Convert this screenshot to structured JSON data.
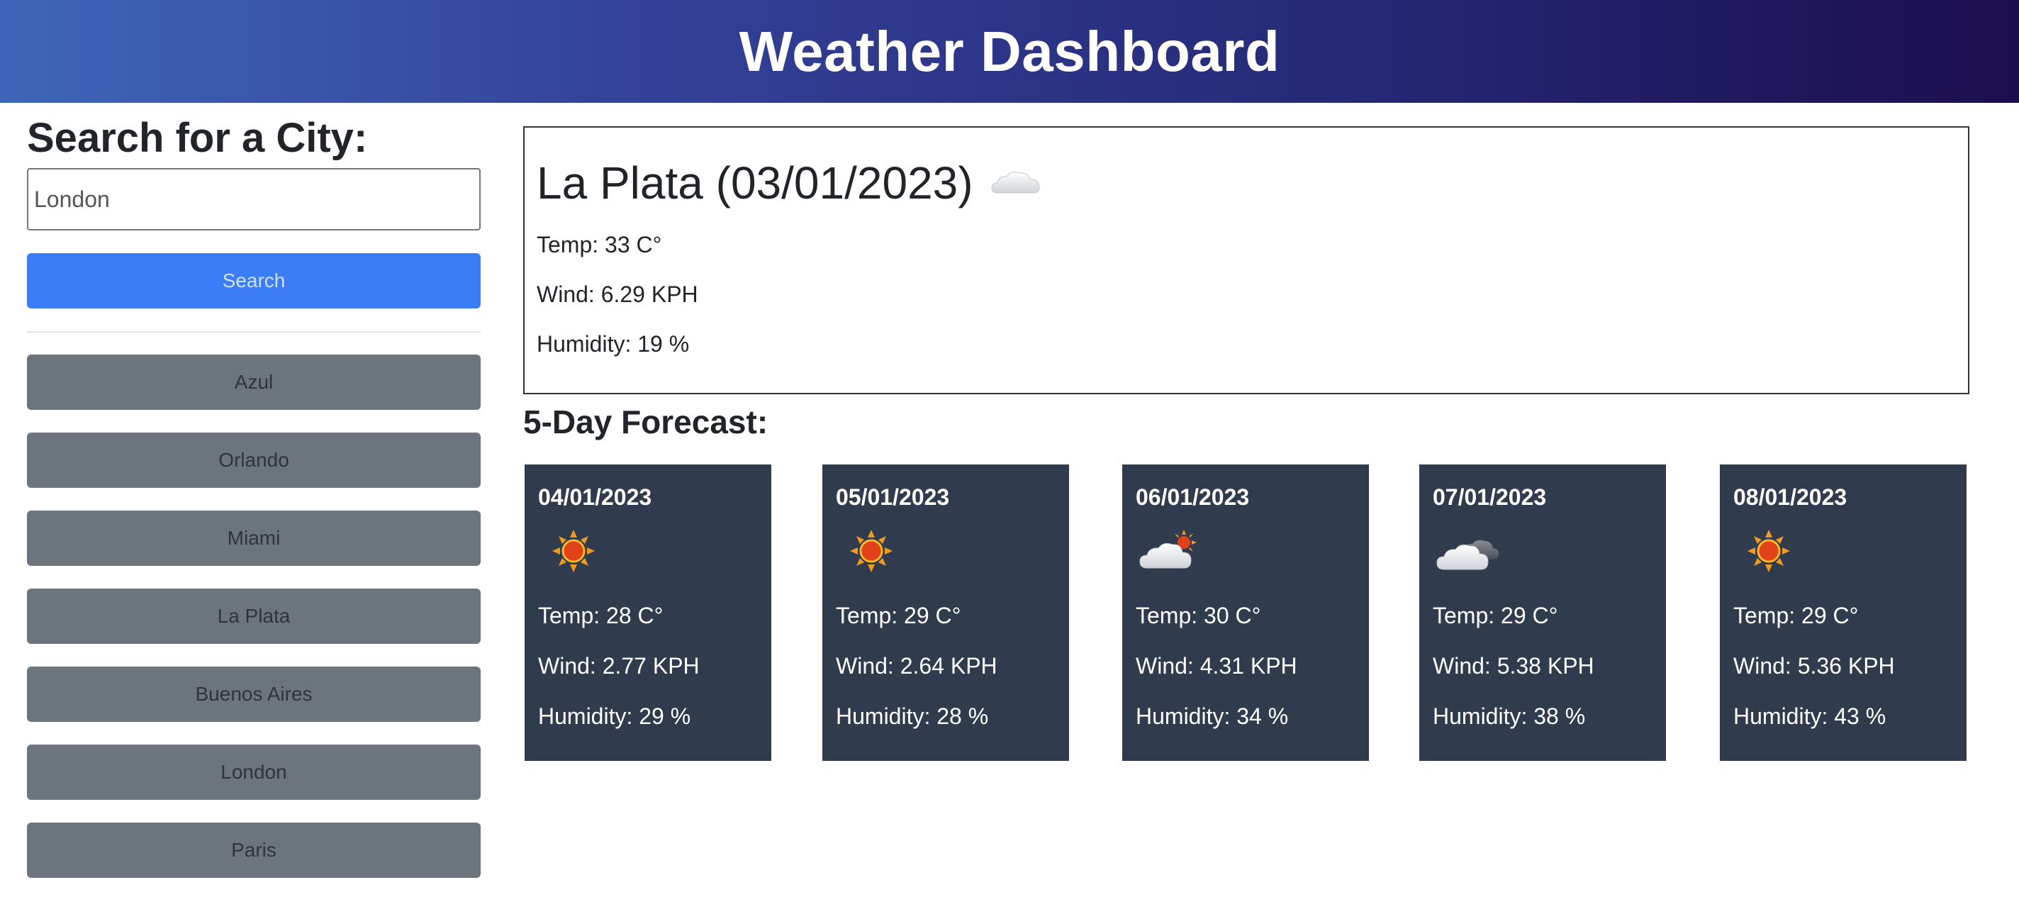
{
  "header": {
    "title": "Weather Dashboard"
  },
  "sidebar": {
    "heading": "Search for a City:",
    "search_input": {
      "value": "London",
      "placeholder": ""
    },
    "search_button_label": "Search",
    "history": [
      {
        "label": "Azul"
      },
      {
        "label": "Orlando"
      },
      {
        "label": "Miami"
      },
      {
        "label": "La Plata"
      },
      {
        "label": "Buenos Aires"
      },
      {
        "label": "London"
      },
      {
        "label": "Paris"
      }
    ]
  },
  "current": {
    "title": "La Plata (03/01/2023)",
    "icon": "cloud-icon",
    "temp": "Temp: 33 C°",
    "wind": "Wind: 6.29 KPH",
    "humidity": "Humidity: 19 %"
  },
  "forecast": {
    "heading": "5-Day Forecast:",
    "days": [
      {
        "date": "04/01/2023",
        "icon": "sun-icon",
        "temp": "Temp: 28 C°",
        "wind": "Wind: 2.77 KPH",
        "humidity": "Humidity: 29 %"
      },
      {
        "date": "05/01/2023",
        "icon": "sun-icon",
        "temp": "Temp: 29 C°",
        "wind": "Wind: 2.64 KPH",
        "humidity": "Humidity: 28 %"
      },
      {
        "date": "06/01/2023",
        "icon": "cloud-sun-icon",
        "temp": "Temp: 30 C°",
        "wind": "Wind: 4.31 KPH",
        "humidity": "Humidity: 34 %"
      },
      {
        "date": "07/01/2023",
        "icon": "cloud-dark-icon",
        "temp": "Temp: 29 C°",
        "wind": "Wind: 5.38 KPH",
        "humidity": "Humidity: 38 %"
      },
      {
        "date": "08/01/2023",
        "icon": "sun-icon",
        "temp": "Temp: 29 C°",
        "wind": "Wind: 5.36 KPH",
        "humidity": "Humidity: 43 %"
      }
    ]
  },
  "colors": {
    "header_start": "#3e66b8",
    "header_end": "#1c0e4e",
    "primary_button": "#3a7df6",
    "history_button": "#6c757d",
    "card_background": "#303c4d"
  }
}
